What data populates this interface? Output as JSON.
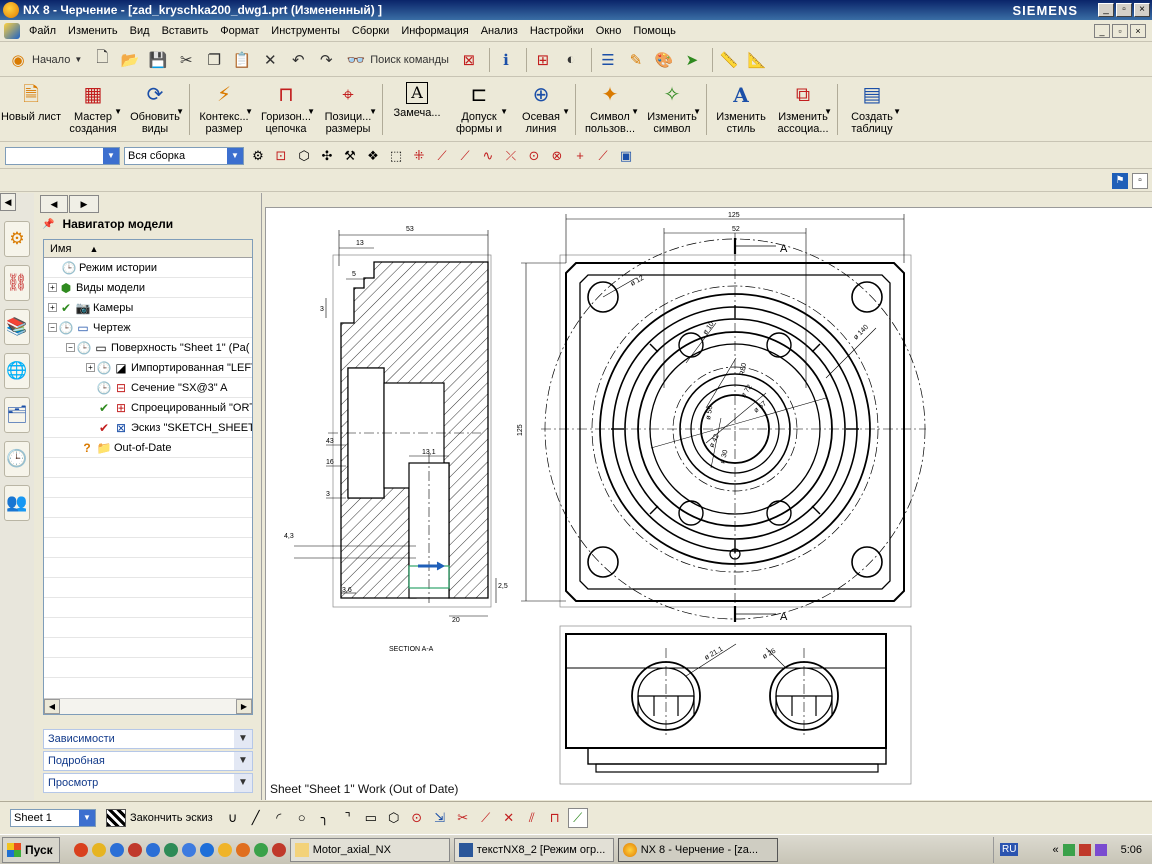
{
  "window": {
    "title": "NX 8 - Черчение - [zad_kryschka200_dwg1.prt (Измененный) ]",
    "brand": "SIEMENS",
    "controls": [
      "_",
      "▫",
      "×"
    ]
  },
  "menu": {
    "items": [
      "Файл",
      "Изменить",
      "Вид",
      "Вставить",
      "Формат",
      "Инструменты",
      "Сборки",
      "Информация",
      "Анализ",
      "Настройки",
      "Окно",
      "Помощь"
    ]
  },
  "toolbar": {
    "start_label": "Начало",
    "command_search": "Поиск команды"
  },
  "ribbon": {
    "new_sheet": "Новый лист",
    "view_wizard": "Мастер создания",
    "update_views": "Обновить виды",
    "context_dim": "Контекс... размер",
    "horizontal_chain": "Горизон... цепочка",
    "positioning_dims": "Позици... размеры",
    "note": "Замеча...",
    "form_tolerance": "Допуск формы и",
    "centerline": "Осевая линия",
    "user_symbol": "Символ пользов...",
    "edit_symbol": "Изменить символ",
    "edit_style": "Изменить стиль",
    "edit_association": "Изменить ассоциа...",
    "create_table": "Создать таблицу"
  },
  "selection": {
    "filter_value": "",
    "scope_value": "Вся сборка"
  },
  "navigator": {
    "title": "Навигатор модели",
    "column_name": "Имя",
    "rows": [
      {
        "label": "Режим истории"
      },
      {
        "label": "Виды модели"
      },
      {
        "label": "Камеры"
      },
      {
        "label": "Чертеж"
      },
      {
        "label": "Поверхность \"Sheet 1\" (Pa("
      },
      {
        "label": "Импортированная \"LEFT"
      },
      {
        "label": "Сечение \"SX@3\" A"
      },
      {
        "label": "Спроецированный \"ORT"
      },
      {
        "label": "Эскиз \"SKETCH_SHEET :"
      },
      {
        "label": "Out-of-Date"
      }
    ],
    "panels": [
      "Зависимости",
      "Подробная",
      "Просмотр"
    ]
  },
  "drawing": {
    "status": "Sheet \"Sheet 1\" Work (Out of Date)",
    "section_caption": "SECTION A-A",
    "section_label": "A",
    "dims": {
      "d53": "53",
      "d13": "13",
      "d5": "5",
      "d3a": "3",
      "d43": "43",
      "d16": "16",
      "d3b": "3",
      "d4_3": "4,3",
      "d13_1": "13,1",
      "d3_6": "3,6",
      "d20": "20",
      "d2_5": "2,5",
      "d125h": "125",
      "d52": "52",
      "d125v": "125",
      "phi12": "ø 12",
      "phi140": "ø 140",
      "phi10": "ø 10",
      "phi67": "ø 67",
      "phi72": "ø 72",
      "phi56": "ø 56",
      "phi42": "ø 42",
      "phi30": "ø 30",
      "d80": "R80",
      "phi21_1": "ø 21,1",
      "phi26": "ø 26"
    }
  },
  "sketchbar": {
    "sheet_value": "Sheet 1",
    "finish_sketch": "Закончить эскиз"
  },
  "taskbar": {
    "start": "Пуск",
    "tasks": [
      "Motor_axial_NX",
      "текстNX8_2 [Режим огр...",
      "NX 8 - Черчение - [za..."
    ],
    "lang": "RU",
    "time": "5:06"
  },
  "colors": {
    "titlebar": "#0a246a",
    "chrome": "#ece9d8",
    "drawing_bg": "#ffffff",
    "accent_blue": "#1f5fb8"
  }
}
